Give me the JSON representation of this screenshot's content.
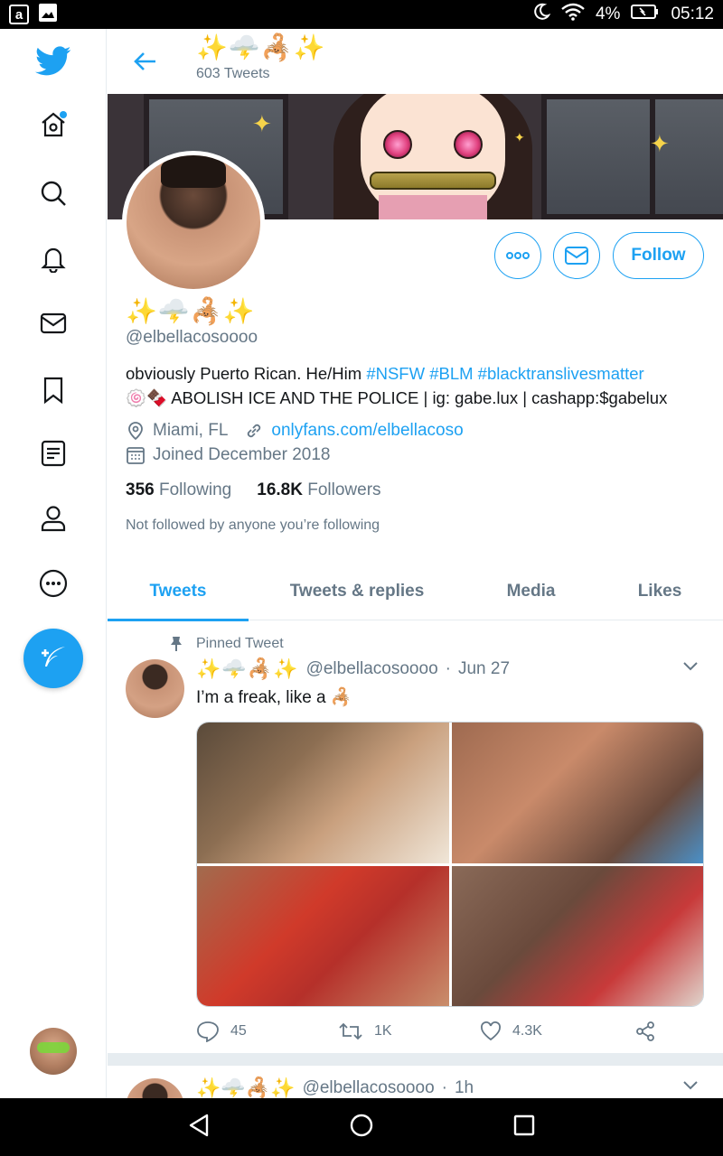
{
  "status_bar": {
    "battery": "4%",
    "time": "05:12",
    "left_icons": [
      "amazon-icon",
      "image-icon"
    ]
  },
  "sidebar": {
    "items": [
      {
        "name": "twitter-logo"
      },
      {
        "name": "home"
      },
      {
        "name": "explore"
      },
      {
        "name": "notifications"
      },
      {
        "name": "messages"
      },
      {
        "name": "bookmarks"
      },
      {
        "name": "lists"
      },
      {
        "name": "profile"
      },
      {
        "name": "more"
      }
    ]
  },
  "header": {
    "name": "✨🌩️🦂✨",
    "tweet_count": "603 Tweets"
  },
  "profile": {
    "display_name": "✨🌩️🦂✨",
    "handle": "@elbellacosoooo",
    "bio_line1_text": "obviously Puerto Rican. He/Him ",
    "bio_tags": [
      "#NSFW",
      "#BLM",
      "#blacktranslivesmatter"
    ],
    "bio_line2_emoji": "🍥🍫",
    "bio_line2_text": "ABOLISH ICE AND THE POLICE | ig: gabe.lux | cashapp:$gabelux",
    "location": "Miami, FL",
    "link": "onlyfans.com/elbellacoso",
    "joined": "Joined December 2018",
    "following_count": "356",
    "following_label": "Following",
    "followers_count": "16.8K",
    "followers_label": "Followers",
    "not_followed": "Not followed by anyone you’re following",
    "follow_label": "Follow"
  },
  "tabs": [
    {
      "label": "Tweets",
      "active": true
    },
    {
      "label": "Tweets & replies",
      "active": false
    },
    {
      "label": "Media",
      "active": false
    },
    {
      "label": "Likes",
      "active": false
    }
  ],
  "tweets": [
    {
      "pinned_label": "Pinned Tweet",
      "name": "✨🌩️🦂✨",
      "handle": "@elbellacosoooo",
      "date": "Jun 27",
      "text": "I’m a freak, like a 🦂",
      "replies": "45",
      "retweets": "1K",
      "likes": "4.3K"
    },
    {
      "name": "✨🌩️🦂✨",
      "handle": "@elbellacosoooo",
      "date": "1h"
    }
  ],
  "colors": {
    "accent": "#1da1f2",
    "secondary_text": "#657786",
    "border": "#e6ecf0"
  }
}
